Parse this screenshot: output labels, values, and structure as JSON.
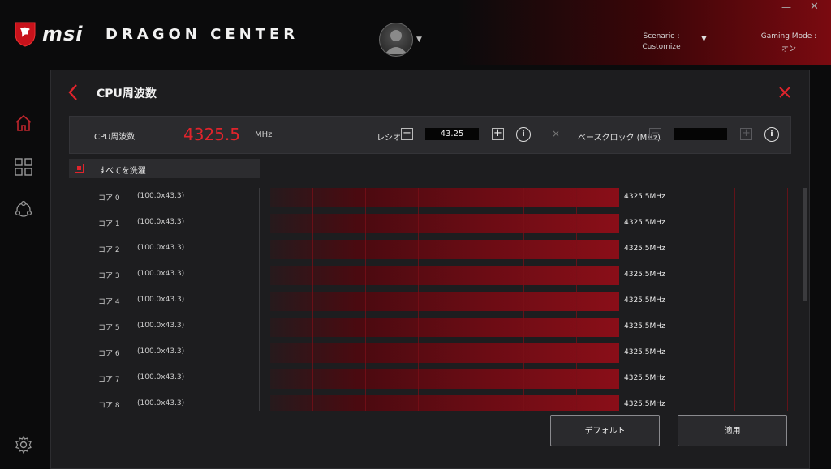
{
  "header": {
    "brand": "msi",
    "app_name": "DRAGON CENTER",
    "scenario_label": "Scenario :",
    "scenario_value": "Customize",
    "gaming_mode_label": "Gaming Mode :",
    "gaming_mode_value": "オン"
  },
  "panel": {
    "title": "CPU周波数",
    "freq_label": "CPU周波数",
    "freq_value": "4325.5",
    "freq_unit": "MHz",
    "ratio_label": "レシオ",
    "ratio_value": "43.25",
    "base_clock_label": "ベースクロック (MHz)",
    "base_clock_value": "",
    "minus": "−",
    "plus": "+",
    "info": "i",
    "separator": "×",
    "select_all_label": "すべてを洗濯",
    "default_button": "デフォルト",
    "apply_button": "適用"
  },
  "cores": [
    {
      "name": "コア 0",
      "multiplier": "(100.0x43.3)",
      "value": "4325.5MHz"
    },
    {
      "name": "コア 1",
      "multiplier": "(100.0x43.3)",
      "value": "4325.5MHz"
    },
    {
      "name": "コア 2",
      "multiplier": "(100.0x43.3)",
      "value": "4325.5MHz"
    },
    {
      "name": "コア 3",
      "multiplier": "(100.0x43.3)",
      "value": "4325.5MHz"
    },
    {
      "name": "コア 4",
      "multiplier": "(100.0x43.3)",
      "value": "4325.5MHz"
    },
    {
      "name": "コア 5",
      "multiplier": "(100.0x43.3)",
      "value": "4325.5MHz"
    },
    {
      "name": "コア 6",
      "multiplier": "(100.0x43.3)",
      "value": "4325.5MHz"
    },
    {
      "name": "コア 7",
      "multiplier": "(100.0x43.3)",
      "value": "4325.5MHz"
    },
    {
      "name": "コア 8",
      "multiplier": "(100.0x43.3)",
      "value": "4325.5MHz"
    }
  ],
  "icons": {
    "logo": "msi-dragon-shield-icon",
    "home": "home-icon",
    "apps": "grid-icon",
    "network": "network-icon",
    "settings": "gear-icon",
    "back": "chevron-left-icon",
    "close": "close-icon"
  },
  "colors": {
    "accent": "#e0242c",
    "bar": "#6a0c14",
    "panel_bg": "#1d1d1f"
  }
}
